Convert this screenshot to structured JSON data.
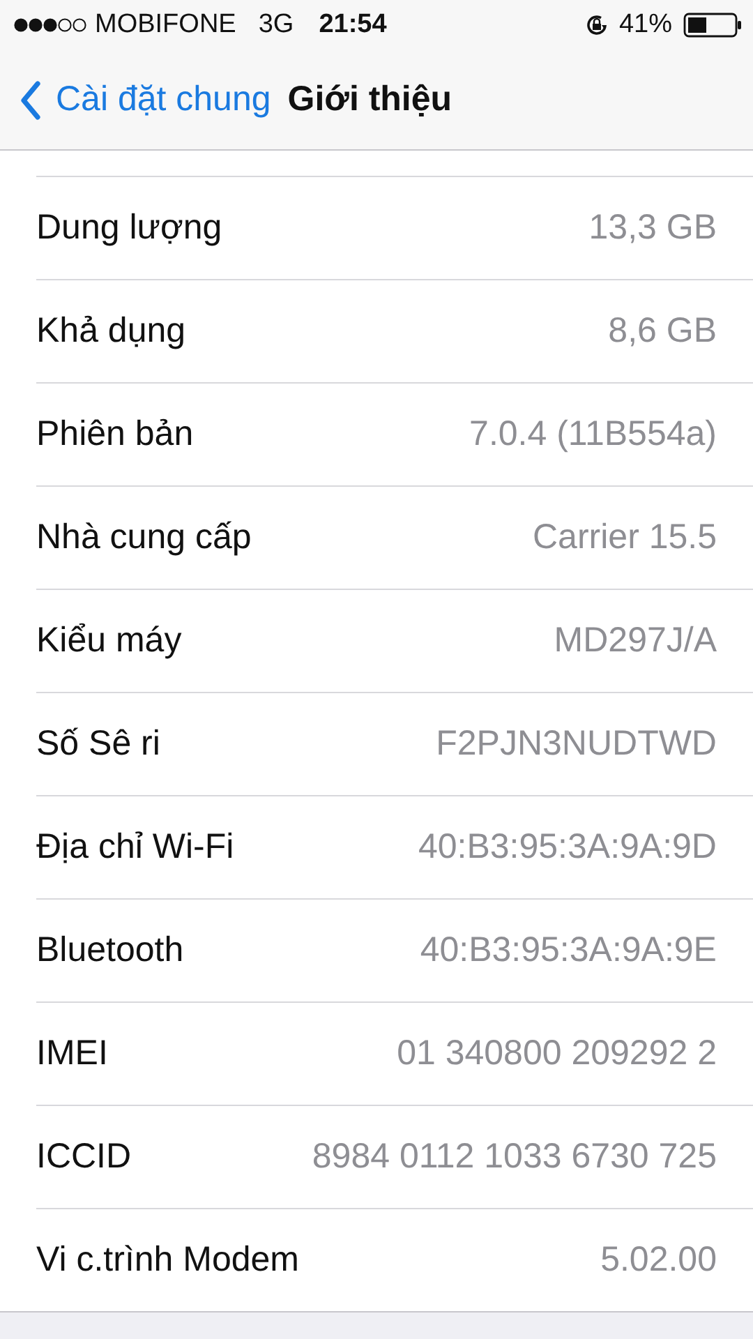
{
  "status_bar": {
    "carrier": "MOBIFONE",
    "network": "3G",
    "time": "21:54",
    "battery": "41%"
  },
  "nav": {
    "back": "Cài đặt chung",
    "title": "Giới thiệu"
  },
  "rows": [
    {
      "label": "Dung lượng",
      "value": "13,3 GB"
    },
    {
      "label": "Khả dụng",
      "value": "8,6 GB"
    },
    {
      "label": "Phiên bản",
      "value": "7.0.4 (11B554a)"
    },
    {
      "label": "Nhà cung cấp",
      "value": "Carrier 15.5"
    },
    {
      "label": "Kiểu máy",
      "value": "MD297J/A"
    },
    {
      "label": "Số Sê ri",
      "value": "F2PJN3NUDTWD"
    },
    {
      "label": "Địa chỉ Wi-Fi",
      "value": "40:B3:95:3A:9A:9D"
    },
    {
      "label": "Bluetooth",
      "value": "40:B3:95:3A:9A:9E"
    },
    {
      "label": "IMEI",
      "value": "01 340800 209292 2"
    },
    {
      "label": "ICCID",
      "value": "8984 0112 1033 6730 725"
    },
    {
      "label": "Vi c.trình Modem",
      "value": "5.02.00"
    }
  ]
}
